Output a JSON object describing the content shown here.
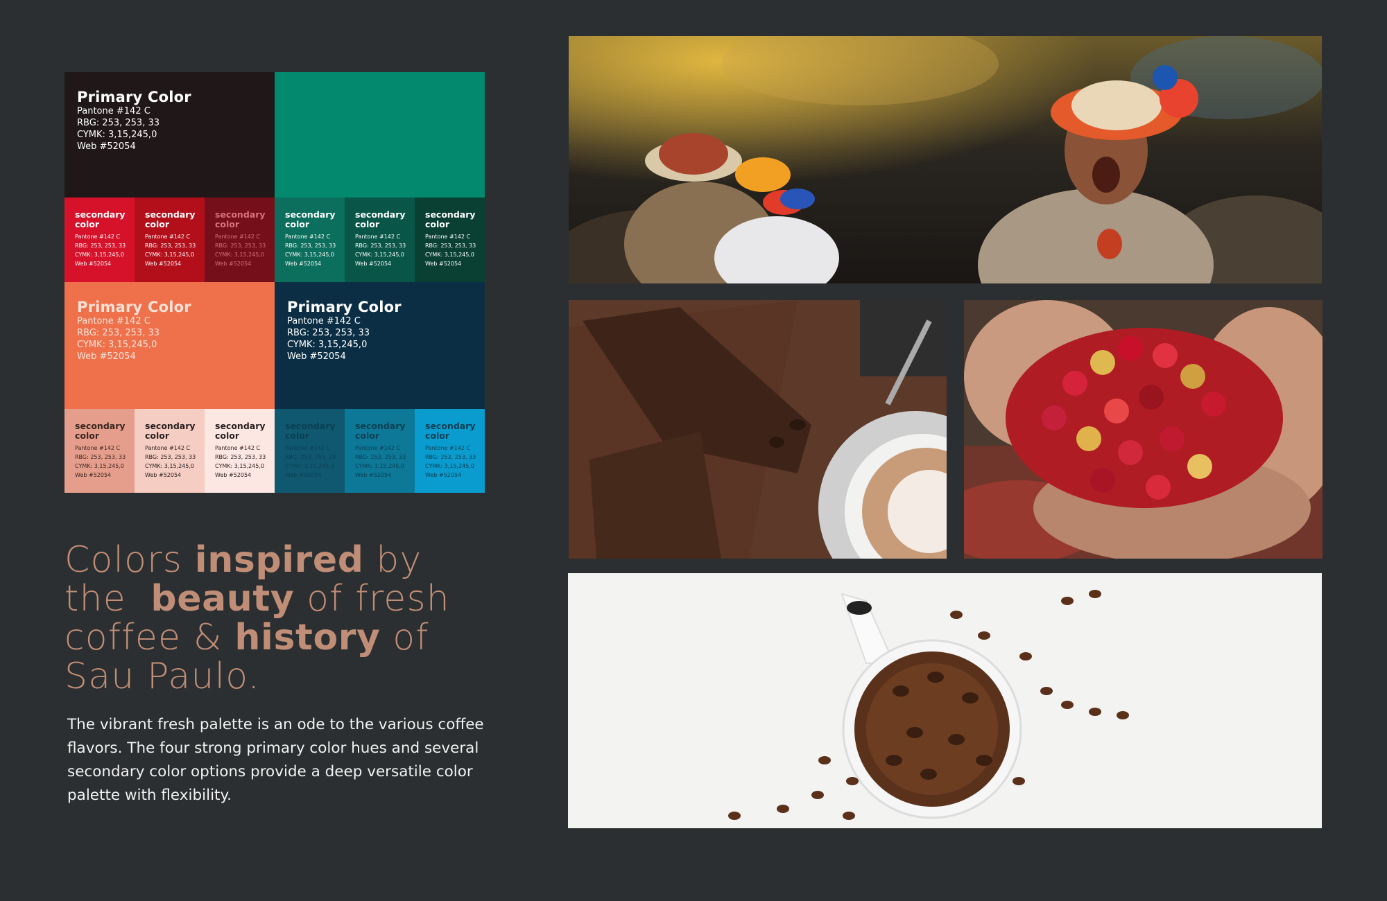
{
  "palette": {
    "primary_blocks": [
      {
        "title": "Primary Color",
        "pantone": "Pantone #142 C",
        "rgb": "RBG: 253, 253, 33",
        "cymk": "CYMK: 3,15,245,0",
        "web": "Web #52054",
        "bg": "#1f1718",
        "fg": "#ffffff"
      },
      {
        "title": "Primary Color",
        "pantone": "Pantone #142 C",
        "rgb": "RBG: 253, 253, 33",
        "cymk": "CYMK: 3,15,245,0",
        "web": "Web #52054",
        "bg": "#ee714c",
        "fg": "#fbe1d6"
      },
      {
        "title": "Primary Color",
        "pantone": "Pantone #142 C",
        "rgb": "RBG: 253, 253, 33",
        "cymk": "CYMK: 3,15,245,0",
        "web": "Web #52054",
        "bg": "#0b2e44",
        "fg": "#ffffff"
      }
    ],
    "secondary_rows": [
      [
        {
          "title": "secondary color",
          "pantone": "Pantone #142 C",
          "rgb": "RBG: 253, 253, 33",
          "cymk": "CYMK: 3,15,245,0",
          "web": "Web #52054",
          "bg": "#d6112a",
          "fg": "#ffffff"
        },
        {
          "title": "secondary color",
          "pantone": "Pantone #142 C",
          "rgb": "RBG: 253, 253, 33",
          "cymk": "CYMK: 3,15,245,0",
          "web": "Web #52054",
          "bg": "#b30f1b",
          "fg": "#ffffff"
        },
        {
          "title": "secondary color",
          "pantone": "Pantone #142 C",
          "rgb": "RBG: 253, 253, 33",
          "cymk": "CYMK: 3,15,245,0",
          "web": "Web #52054",
          "bg": "#75101a",
          "fg": "#d9707c"
        },
        {
          "title": "secondary color",
          "pantone": "Pantone #142 C",
          "rgb": "RBG: 253, 253, 33",
          "cymk": "CYMK: 3,15,245,0",
          "web": "Web #52054",
          "bg": "#0c6e5d",
          "fg": "#ffffff"
        },
        {
          "title": "secondary color",
          "pantone": "Pantone #142 C",
          "rgb": "RBG: 253, 253, 33",
          "cymk": "CYMK: 3,15,245,0",
          "web": "Web #52054",
          "bg": "#095648",
          "fg": "#ffffff"
        },
        {
          "title": "secondary color",
          "pantone": "Pantone #142 C",
          "rgb": "RBG: 253, 253, 33",
          "cymk": "CYMK: 3,15,245,0",
          "web": "Web #52054",
          "bg": "#0a4034",
          "fg": "#ffffff"
        }
      ],
      [
        {
          "title": "secondary color",
          "pantone": "Pantone #142 C",
          "rgb": "RBG: 253, 253, 33",
          "cymk": "CYMK: 3,15,245,0",
          "web": "Web #52054",
          "bg": "#e69e8c",
          "fg": "#3a2520"
        },
        {
          "title": "secondary color",
          "pantone": "Pantone #142 C",
          "rgb": "RBG: 253, 253, 33",
          "cymk": "CYMK: 3,15,245,0",
          "web": "Web #52054",
          "bg": "#f6cdc2",
          "fg": "#2a2020"
        },
        {
          "title": "secondary color",
          "pantone": "Pantone #142 C",
          "rgb": "RBG: 253, 253, 33",
          "cymk": "CYMK: 3,15,245,0",
          "web": "Web #52054",
          "bg": "#fce7e2",
          "fg": "#2a2020"
        },
        {
          "title": "secondary color",
          "pantone": "Pantone #142 C",
          "rgb": "RBG: 253, 253, 33",
          "cymk": "CYMK: 3,15,245,0",
          "web": "Web #52054",
          "bg": "#0f5870",
          "fg": "#0b3f52"
        },
        {
          "title": "secondary color",
          "pantone": "Pantone #142 C",
          "rgb": "RBG: 253, 253, 33",
          "cymk": "CYMK: 3,15,245,0",
          "web": "Web #52054",
          "bg": "#0d7898",
          "fg": "#0b3f52"
        },
        {
          "title": "secondary color",
          "pantone": "Pantone #142 C",
          "rgb": "RBG: 253, 253, 33",
          "cymk": "CYMK: 3,15,245,0",
          "web": "Web #52054",
          "bg": "#0a9ccf",
          "fg": "#0b3f52"
        }
      ]
    ],
    "teal_block_color": "#03896d"
  },
  "headline": {
    "parts": [
      {
        "text": "Colors ",
        "strong": false
      },
      {
        "text": "inspired",
        "strong": true
      },
      {
        "text": " by the  ",
        "strong": false
      },
      {
        "text": "beauty",
        "strong": true
      },
      {
        "text": " of fresh coffee & ",
        "strong": false
      },
      {
        "text": "history",
        "strong": true
      },
      {
        "text": " of Sau Paulo.",
        "strong": false
      }
    ],
    "color": "#c08d76"
  },
  "body_text": "The vibrant fresh palette is an ode to the various coffee flavors. The four strong primary color hues and several secondary color options provide a deep versatile color palette with flexibility.",
  "background_color": "#2b2f31"
}
